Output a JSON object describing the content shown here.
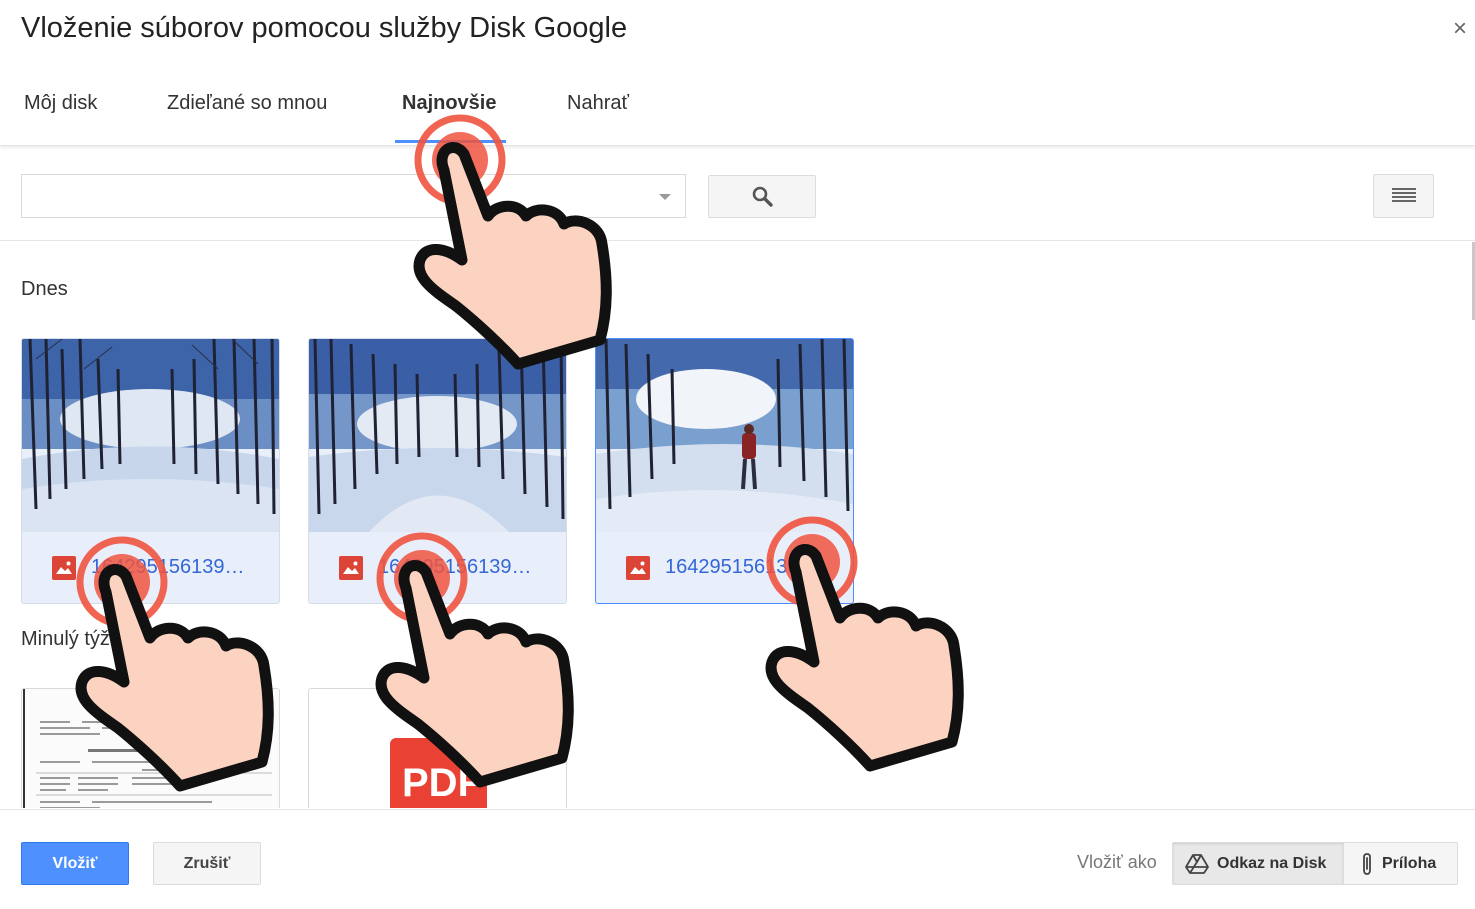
{
  "dialog": {
    "title": "Vloženie súborov pomocou služby Disk Google",
    "close_label": "×"
  },
  "tabs": [
    {
      "label": "Môj disk"
    },
    {
      "label": "Zdieľané so mnou"
    },
    {
      "label": "Najnovšie",
      "active": true
    },
    {
      "label": "Nahrať"
    }
  ],
  "search": {
    "value": "",
    "placeholder": ""
  },
  "sections": {
    "today": "Dnes",
    "last_week": "Minulý týždeň"
  },
  "files_today": [
    {
      "name": "1642951561390.jpg",
      "type": "image"
    },
    {
      "name": "1642951561390.jpg",
      "type": "image"
    },
    {
      "name": "1642951561390.jpg",
      "type": "image",
      "selected": true
    }
  ],
  "files_last_week": [
    {
      "type": "document"
    },
    {
      "type": "pdf",
      "icon_text": "PDF"
    }
  ],
  "footer": {
    "insert_label": "Vložiť",
    "cancel_label": "Zrušiť",
    "insert_as_label": "Vložiť ako",
    "drive_link_label": "Odkaz na Disk",
    "attachment_label": "Príloha"
  },
  "colors": {
    "accent": "#4d90fe",
    "link": "#3367d6",
    "image_icon": "#db4437",
    "pdf_red": "#e94235",
    "hand_fill": "#fcd3c1",
    "tap_ring": "#f0533f"
  }
}
